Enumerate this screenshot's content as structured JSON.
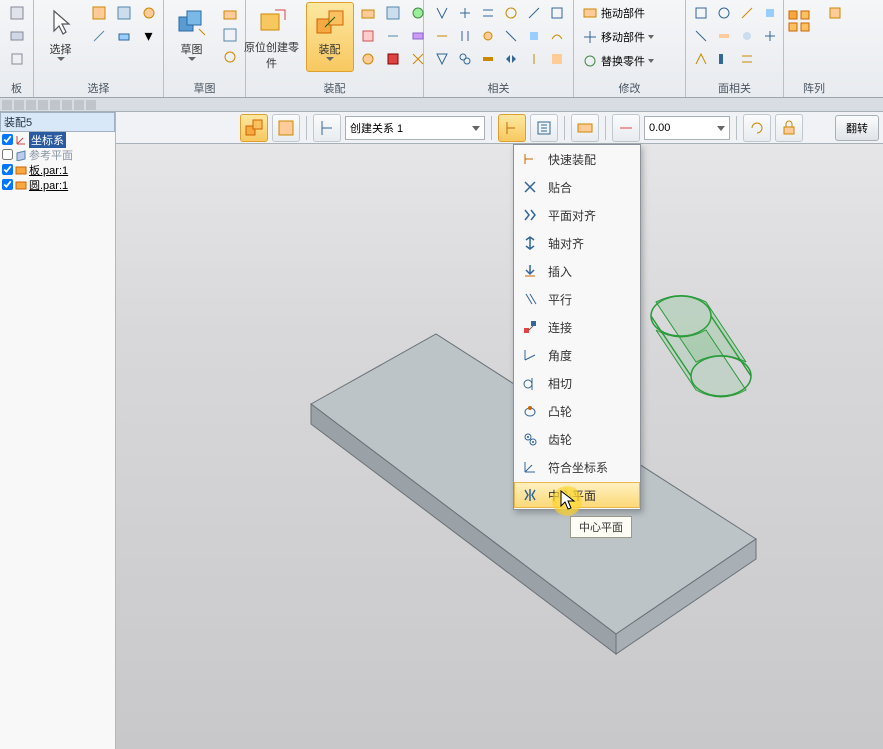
{
  "ribbon": {
    "groups": [
      {
        "label": "板"
      },
      {
        "label": "选择",
        "big": "选择"
      },
      {
        "label": "草图",
        "big": "草图"
      },
      {
        "label": "装配",
        "big1": "原位创建零件",
        "big2": "装配"
      },
      {
        "label": "相关"
      },
      {
        "label": "修改",
        "rows": [
          "拖动部件",
          "移动部件",
          "替换零件"
        ]
      },
      {
        "label": "面相关"
      },
      {
        "label": "阵列"
      }
    ]
  },
  "tree": {
    "header": "装配5",
    "items": [
      {
        "label": "坐标系",
        "checked": true,
        "hl": true
      },
      {
        "label": "参考平面",
        "checked": false,
        "dim": true
      },
      {
        "label": "板.par:1",
        "checked": true
      },
      {
        "label": "圆.par:1",
        "checked": true
      }
    ]
  },
  "toolbar2": {
    "combo": "创建关系 1",
    "value": "0.00",
    "endBtn": "翻转"
  },
  "menu": {
    "items": [
      {
        "label": "快速装配"
      },
      {
        "label": "贴合"
      },
      {
        "label": "平面对齐"
      },
      {
        "label": "轴对齐"
      },
      {
        "label": "插入"
      },
      {
        "label": "平行"
      },
      {
        "label": "连接"
      },
      {
        "label": "角度"
      },
      {
        "label": "相切"
      },
      {
        "label": "凸轮"
      },
      {
        "label": "齿轮"
      },
      {
        "label": "符合坐标系"
      },
      {
        "label": "中心平面",
        "hover": true
      }
    ]
  },
  "tooltip": "中心平面"
}
